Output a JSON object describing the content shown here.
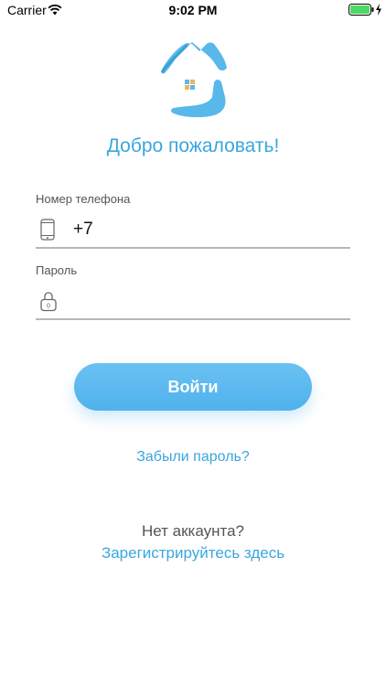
{
  "status_bar": {
    "carrier": "Carrier",
    "time": "9:02 PM",
    "battery_color": "#4cd964"
  },
  "logo": {
    "icon": "house-hands-logo",
    "color": "#58b8ea"
  },
  "welcome_title": "Добро пожаловать!",
  "phone": {
    "label": "Номер телефона",
    "value": "+7",
    "icon": "phone-icon"
  },
  "password": {
    "label": "Пароль",
    "value": "",
    "icon": "lock-icon"
  },
  "login_button": {
    "label": "Войти"
  },
  "forgot_link": "Забыли пароль?",
  "no_account_text": "Нет аккаунта?",
  "register_link": "Зарегистрируйтесь здесь",
  "colors": {
    "accent": "#3aa6de",
    "button": "#5ab8ee",
    "label_text": "#555555",
    "underline": "#b8b8b8"
  }
}
